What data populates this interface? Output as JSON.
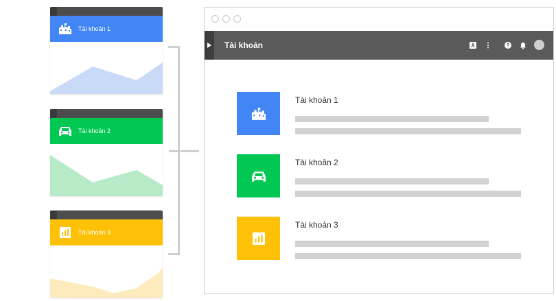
{
  "colors": {
    "blue": "#4285f4",
    "green": "#00c853",
    "amber": "#ffc107",
    "dark": "#5a5a5a"
  },
  "cards": [
    {
      "label": "Tài khoản 1",
      "icon": "city-icon",
      "color": "#4285f4",
      "chart_color": "#c9daf8"
    },
    {
      "label": "Tài khoản 2",
      "icon": "car-icon",
      "color": "#00c853",
      "chart_color": "#b7ebc8"
    },
    {
      "label": "Tài khoản 3",
      "icon": "bar-chart-icon",
      "color": "#ffc107",
      "chart_color": "#fdebbd"
    }
  ],
  "window": {
    "appbar_title": "Tài khoản",
    "actions": [
      "translate-icon",
      "more-vert-icon",
      "help-icon",
      "notifications-icon",
      "avatar"
    ],
    "accounts": [
      {
        "label": "Tài khoản 1",
        "icon": "city-icon"
      },
      {
        "label": "Tài khoản 2",
        "icon": "car-icon"
      },
      {
        "label": "Tài khoản 3",
        "icon": "bar-chart-icon"
      }
    ]
  }
}
